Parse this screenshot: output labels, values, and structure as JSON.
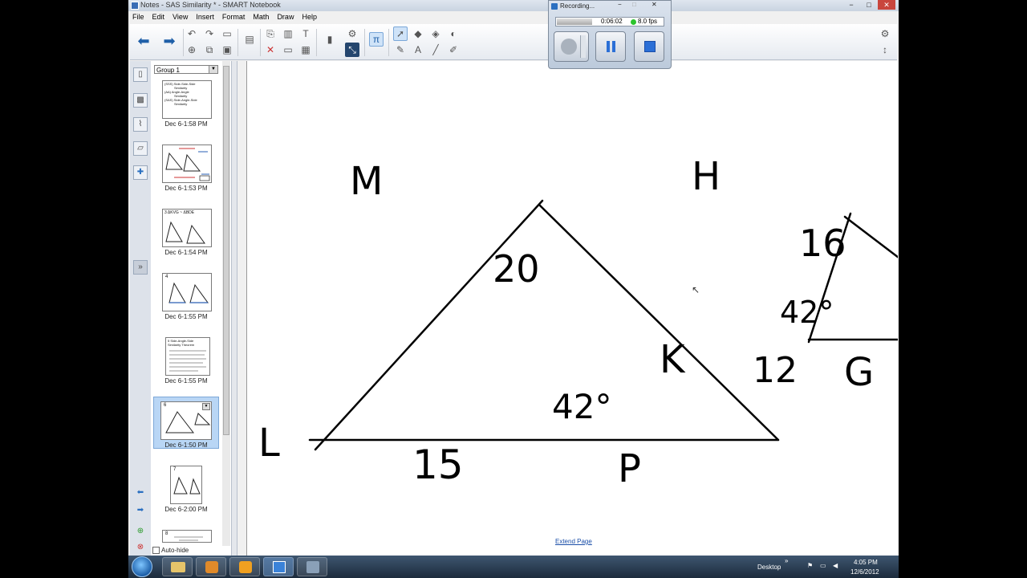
{
  "window": {
    "title": "Notes - SAS Similarity * - SMART Notebook",
    "controls": [
      "−",
      "□",
      "✕"
    ]
  },
  "menu": [
    "File",
    "Edit",
    "View",
    "Insert",
    "Format",
    "Math",
    "Draw",
    "Help"
  ],
  "recorder": {
    "title": "Recording...",
    "controls": [
      "−",
      "□",
      "✕"
    ],
    "time": "0:06:02",
    "fps": "8.0 fps"
  },
  "sorter": {
    "group": "Group 1",
    "pages": [
      {
        "label": "Dec 6-1:58 PM",
        "lines": [
          "(SSS) Side-Side-Side",
          "Similarity",
          "(AA) Angle-Angle",
          "Similarity",
          "(SAS) Side-Angle-Side",
          "Similarity"
        ]
      },
      {
        "label": "Dec 6-1:53 PM"
      },
      {
        "label": "Dec 6-1:54 PM",
        "lines": [
          "3 ΔKVG ~ ΔBDE"
        ]
      },
      {
        "label": "Dec 6-1:55 PM",
        "lines": [
          "4"
        ]
      },
      {
        "label": "Dec 6-1:55 PM",
        "lines": [
          "5 Side-Angle-Side",
          "Similarity Theorem"
        ]
      },
      {
        "label": "Dec 6-1:50 PM",
        "lines": [
          "6"
        ]
      },
      {
        "label": "Dec 6-2:00 PM",
        "lines": [
          "7"
        ]
      },
      {
        "label": "",
        "lines": [
          "8"
        ]
      }
    ],
    "autohide": "Auto-hide"
  },
  "canvas": {
    "extend_page": "Extend Page",
    "labels": {
      "M": "M",
      "L": "L",
      "P": "P",
      "H": "H",
      "K": "K",
      "G": "G"
    },
    "measures": {
      "lm20": "20",
      "lp15": "15",
      "p42": "42°",
      "hg16": "16",
      "kg12": "12",
      "g42": "42°"
    }
  },
  "taskbar": {
    "desktop": "Desktop",
    "time": "4:05 PM",
    "date": "12/6/2012"
  },
  "colors": {
    "accent": "#1f5fa8",
    "selection": "#b9d6f5",
    "taskbar": "#1c2b3c"
  }
}
